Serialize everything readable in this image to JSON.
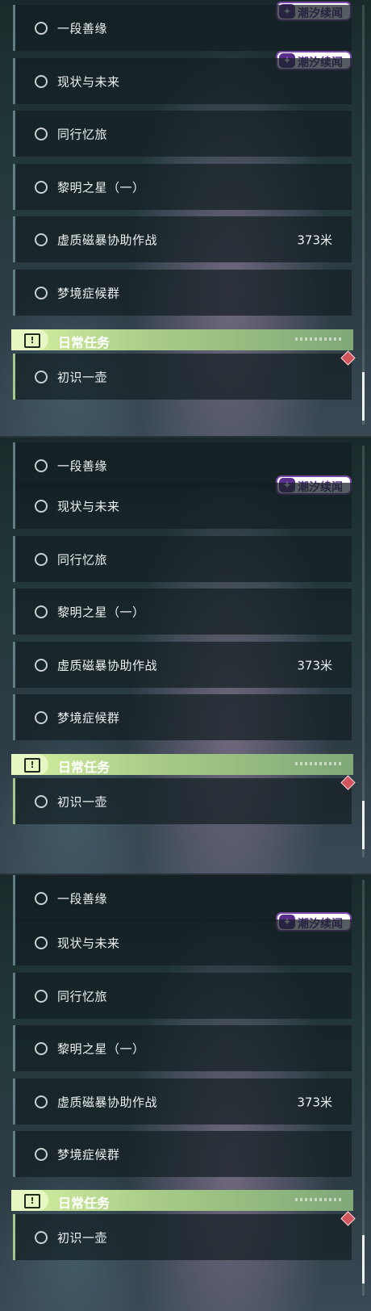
{
  "panels": [
    {
      "quests": [
        {
          "label": "一段善缘"
        },
        {
          "label": "现状与未来"
        },
        {
          "label": "同行忆旅"
        },
        {
          "label": "黎明之星（一）"
        },
        {
          "label": "虚质磁暴协助作战",
          "distance": "373米"
        },
        {
          "label": "梦境症候群"
        }
      ],
      "section_title": "日常任务",
      "daily_quest": {
        "label": "初识一壶"
      },
      "tag_label": "潮汐续闻"
    },
    {
      "quests": [
        {
          "label": "一段善缘"
        },
        {
          "label": "现状与未来"
        },
        {
          "label": "同行忆旅"
        },
        {
          "label": "黎明之星（一）"
        },
        {
          "label": "虚质磁暴协助作战",
          "distance": "373米"
        },
        {
          "label": "梦境症候群"
        }
      ],
      "section_title": "日常任务",
      "daily_quest": {
        "label": "初识一壶"
      },
      "tag_label": "潮汐续闻"
    },
    {
      "quests": [
        {
          "label": "一段善缘"
        },
        {
          "label": "现状与未来"
        },
        {
          "label": "同行忆旅"
        },
        {
          "label": "黎明之星（一）"
        },
        {
          "label": "虚质磁暴协助作战",
          "distance": "373米"
        },
        {
          "label": "梦境症候群"
        }
      ],
      "section_title": "日常任务",
      "daily_quest": {
        "label": "初识一壶"
      },
      "tag_label": "潮汐续闻"
    }
  ],
  "icons": {
    "quest_status": "circle-icon",
    "section": "exclamation-icon",
    "tag": "sparkle-icon",
    "marker": "diamond-marker-icon"
  },
  "colors": {
    "section_header": "#a9cd88",
    "marker": "#d2545c",
    "tag_accent": "#5a2f8c"
  }
}
